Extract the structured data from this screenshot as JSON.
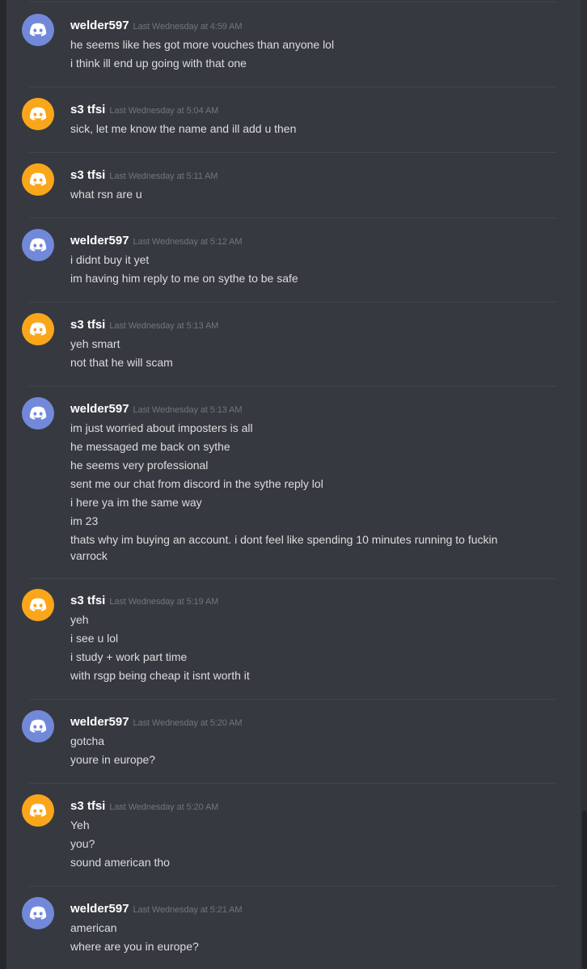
{
  "colors": {
    "blurple": "#7289da",
    "orange": "#faa61a",
    "chat_bg": "#36393f",
    "text": "#dcddde",
    "timestamp": "#72767d"
  },
  "messages": [
    {
      "author": "welder597",
      "avatar": "discord-logo-blurple",
      "timestamp": "Last Wednesday at 4:59 AM",
      "lines": [
        "he seems like hes got more vouches than anyone lol",
        "i think ill end up going with that one"
      ]
    },
    {
      "author": "s3 tfsi",
      "avatar": "discord-logo-orange",
      "timestamp": "Last Wednesday at 5:04 AM",
      "lines": [
        "sick, let me know the name and ill add u then"
      ]
    },
    {
      "author": "s3 tfsi",
      "avatar": "discord-logo-orange",
      "timestamp": "Last Wednesday at 5:11 AM",
      "lines": [
        "what rsn are u"
      ]
    },
    {
      "author": "welder597",
      "avatar": "discord-logo-blurple",
      "timestamp": "Last Wednesday at 5:12 AM",
      "lines": [
        "i didnt buy it yet",
        "im having him reply to me on sythe to be safe"
      ]
    },
    {
      "author": "s3 tfsi",
      "avatar": "discord-logo-orange",
      "timestamp": "Last Wednesday at 5:13 AM",
      "lines": [
        "yeh smart",
        "not that he will scam"
      ]
    },
    {
      "author": "welder597",
      "avatar": "discord-logo-blurple",
      "timestamp": "Last Wednesday at 5:13 AM",
      "lines": [
        "im just worried about imposters is all",
        "he messaged me back on sythe",
        "he seems very professional",
        "sent me our chat from discord in the sythe reply lol",
        "i here ya im the same way",
        "im 23",
        "thats why im buying an account. i dont feel like spending 10 minutes running to fuckin varrock"
      ]
    },
    {
      "author": "s3 tfsi",
      "avatar": "discord-logo-orange",
      "timestamp": "Last Wednesday at 5:19 AM",
      "lines": [
        "yeh",
        "i see u lol",
        "i study + work part time",
        "with rsgp being cheap it isnt worth it"
      ]
    },
    {
      "author": "welder597",
      "avatar": "discord-logo-blurple",
      "timestamp": "Last Wednesday at 5:20 AM",
      "lines": [
        "gotcha",
        "youre in europe?"
      ]
    },
    {
      "author": "s3 tfsi",
      "avatar": "discord-logo-orange",
      "timestamp": "Last Wednesday at 5:20 AM",
      "lines": [
        "Yeh",
        "you?",
        "sound american tho"
      ]
    },
    {
      "author": "welder597",
      "avatar": "discord-logo-blurple",
      "timestamp": "Last Wednesday at 5:21 AM",
      "lines": [
        "american",
        "where are you in europe?"
      ]
    }
  ]
}
